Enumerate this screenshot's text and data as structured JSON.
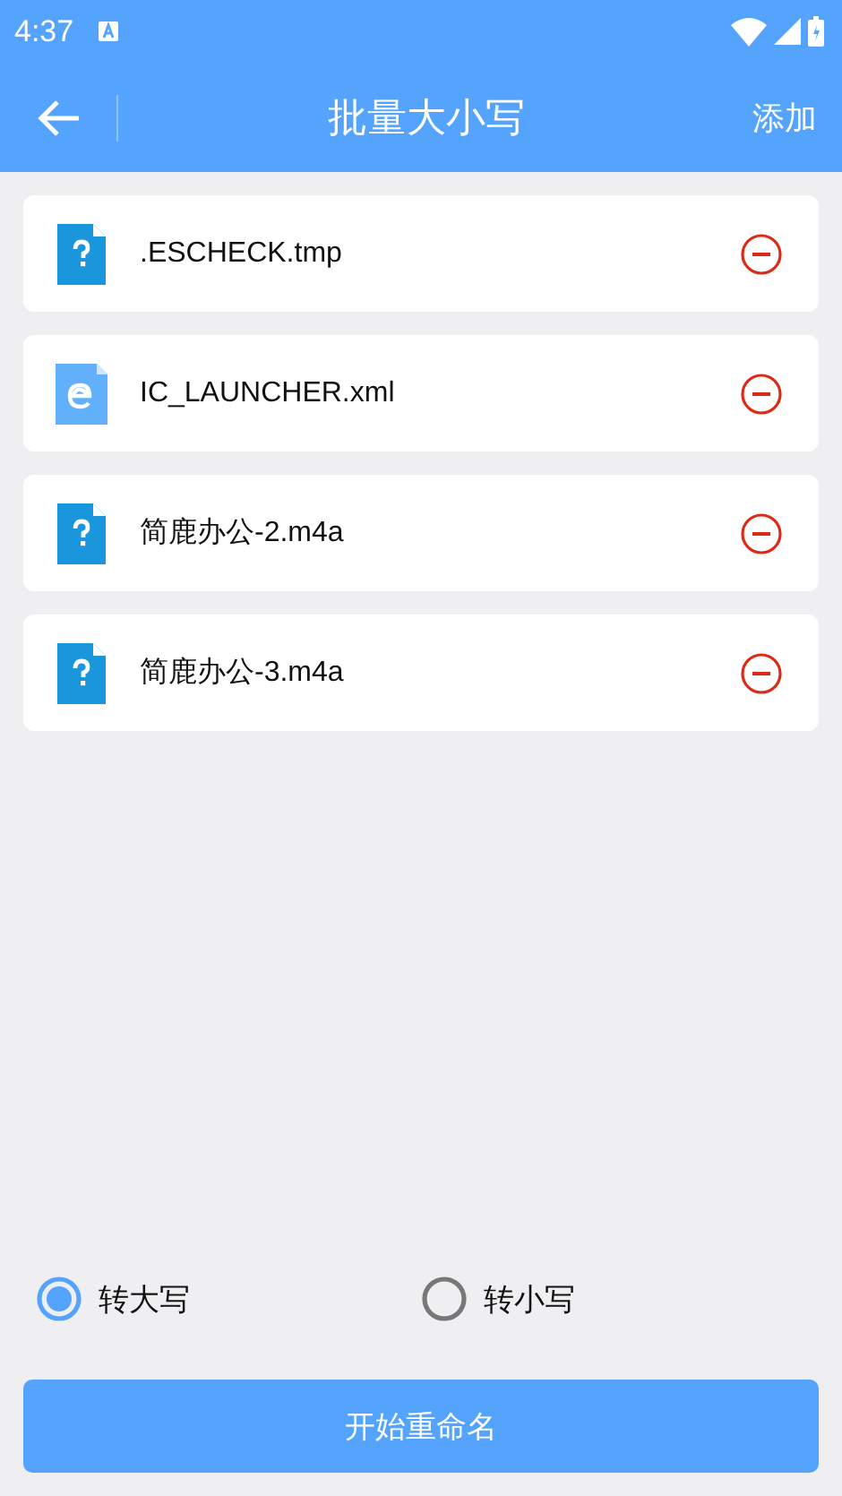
{
  "status_bar": {
    "time": "4:37"
  },
  "app_bar": {
    "title": "批量大小写",
    "action": "添加"
  },
  "files": [
    {
      "name": ".ESCHECK.tmp",
      "kind": "unknown"
    },
    {
      "name": "IC_LAUNCHER.xml",
      "kind": "web"
    },
    {
      "name": "简鹿办公-2.m4a",
      "kind": "unknown"
    },
    {
      "name": "简鹿办公-3.m4a",
      "kind": "unknown"
    }
  ],
  "options": [
    {
      "label": "转大写",
      "selected": true
    },
    {
      "label": "转小写",
      "selected": false
    }
  ],
  "start_button": "开始重命名"
}
